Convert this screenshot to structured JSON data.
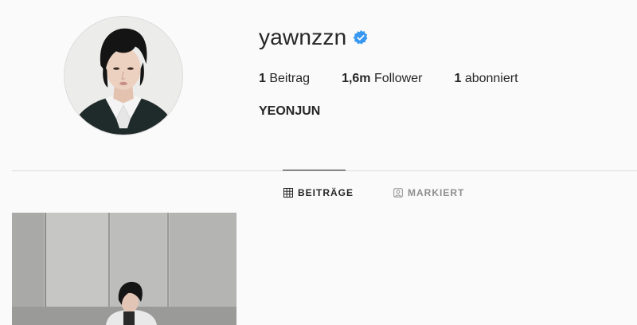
{
  "profile": {
    "username": "yawnzzn",
    "full_name": "YEONJUN",
    "verified": true,
    "verified_color": "#3897f0",
    "avatar_icon": "profile-photo"
  },
  "stats": {
    "posts_count": "1",
    "posts_label": "Beitrag",
    "followers_count": "1,6m",
    "followers_label": "Follower",
    "following_count": "1",
    "following_label": "abonniert"
  },
  "tabs": [
    {
      "label": "BEITRÄGE",
      "icon": "grid-icon",
      "active": true
    },
    {
      "label": "MARKIERT",
      "icon": "tagged-icon",
      "active": false
    }
  ],
  "posts": [
    {
      "icon": "post-photo"
    }
  ]
}
